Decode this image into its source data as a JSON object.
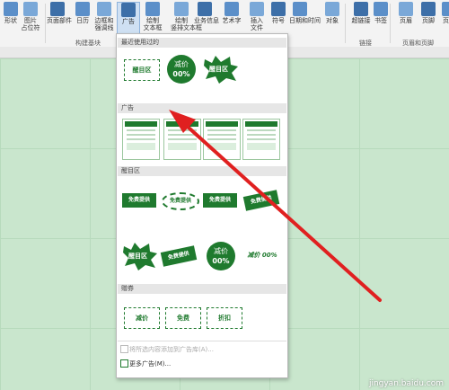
{
  "ribbon": {
    "buttons": [
      {
        "label": "形状",
        "icon": "shapes-icon"
      },
      {
        "label": "图片\n占位符",
        "icon": "picture-placeholder-icon"
      },
      {
        "label": "页面部件",
        "icon": "page-parts-icon"
      },
      {
        "label": "日历",
        "icon": "calendar-icon"
      },
      {
        "label": "边框和\n强调线",
        "icon": "borders-icon"
      },
      {
        "label": "广告",
        "icon": "advertisement-icon"
      },
      {
        "label": "绘制\n文本框",
        "icon": "draw-textbox-icon"
      },
      {
        "label": "绘制\n竖排文本框",
        "icon": "draw-vertical-textbox-icon"
      },
      {
        "label": "业务信息",
        "icon": "business-info-icon"
      },
      {
        "label": "艺术字",
        "icon": "wordart-icon"
      },
      {
        "label": "插入\n文件",
        "icon": "insert-file-icon"
      },
      {
        "label": "符号",
        "icon": "symbol-icon"
      },
      {
        "label": "日期和时间",
        "icon": "date-time-icon"
      },
      {
        "label": "对象",
        "icon": "object-icon"
      },
      {
        "label": "超链接",
        "icon": "hyperlink-icon"
      },
      {
        "label": "书签",
        "icon": "bookmark-icon"
      },
      {
        "label": "页眉",
        "icon": "header-icon"
      },
      {
        "label": "页脚",
        "icon": "footer-icon"
      },
      {
        "label": "页码",
        "icon": "page-number-icon"
      }
    ],
    "groups": [
      "构建基块",
      "链接",
      "页眉和页脚"
    ]
  },
  "panel": {
    "recent_header": "最近使用过的",
    "ads_header": "广告",
    "attention_header": "醒目区",
    "coupons_header": "赠券",
    "recent_items": [
      {
        "kind": "coupon",
        "text": "醒目区"
      },
      {
        "kind": "circle",
        "line1": "减价",
        "line2": "00%"
      },
      {
        "kind": "burst",
        "text": "醒目区"
      }
    ],
    "attention_row1": [
      {
        "kind": "banner",
        "text": "免费提供"
      },
      {
        "kind": "oval",
        "text": "免费提供"
      },
      {
        "kind": "ribbon",
        "text": "免费提供"
      },
      {
        "kind": "tilted",
        "text": "免费提供"
      }
    ],
    "attention_row2": [
      {
        "kind": "burst",
        "text": "醒目区"
      },
      {
        "kind": "tilted2",
        "text": "免费提供"
      },
      {
        "kind": "circle",
        "line1": "减价",
        "line2": "00%"
      },
      {
        "kind": "plain",
        "text": "减价 00%"
      }
    ],
    "coupon_items": [
      {
        "kind": "coupon",
        "text": "减价"
      },
      {
        "kind": "coupon",
        "text": "免费"
      },
      {
        "kind": "coupon",
        "text": "折扣"
      }
    ],
    "footer_disabled": "将所选内容添加到广告库(A)...",
    "footer_more": "更多广告(M)..."
  },
  "colors": {
    "accent": "#1f7a2e",
    "doc": "#c9e6cd",
    "arrow": "#e02020"
  },
  "watermark": "jingyan.baidu.com"
}
